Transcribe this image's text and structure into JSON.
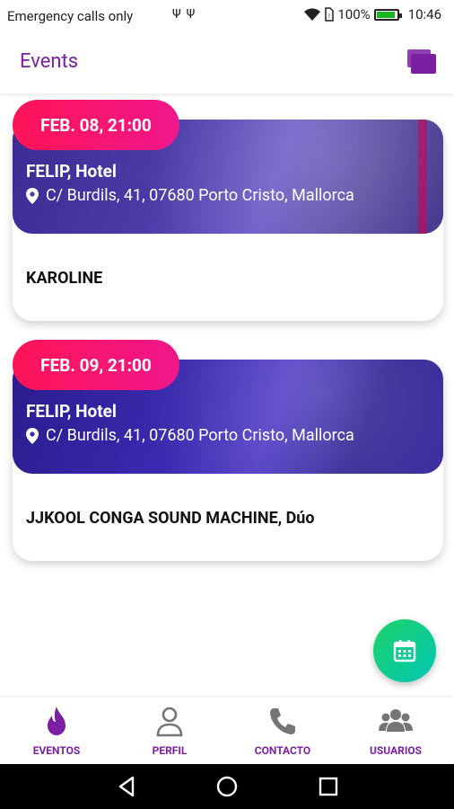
{
  "status_bar": {
    "carrier": "Emergency calls only",
    "usb_icons": "ΨΨ",
    "battery_percent": "100%",
    "time": "10:46",
    "battery_color": "#19b61f"
  },
  "app_bar": {
    "title": "Events",
    "menu_icon": "collections-icon"
  },
  "events": [
    {
      "date": "FEB. 08, 21:00",
      "venue": "FELIP, Hotel",
      "address": "C/ Burdils, 41, 07680 Porto Cristo, Mallorca",
      "name": "KAROLINE"
    },
    {
      "date": "FEB. 09, 21:00",
      "venue": "FELIP, Hotel",
      "address": "C/ Burdils, 41, 07680 Porto Cristo, Mallorca",
      "name": "JJKOOL CONGA SOUND MACHINE, Dúo"
    }
  ],
  "fab": {
    "icon": "calendar-icon"
  },
  "bottom_nav": {
    "items": [
      {
        "label": "EVENTOS",
        "icon": "flame-icon"
      },
      {
        "label": "PERFIL",
        "icon": "person-icon"
      },
      {
        "label": "CONTACTO",
        "icon": "phone-icon"
      },
      {
        "label": "USUARIOS",
        "icon": "group-icon"
      }
    ]
  },
  "colors": {
    "accent": "#7b1fa2",
    "badge_start": "#ff1457",
    "badge_end": "#f0178b",
    "fab_start": "#1ed36a",
    "fab_end": "#00c6b3",
    "inactive_icon": "#757575"
  }
}
